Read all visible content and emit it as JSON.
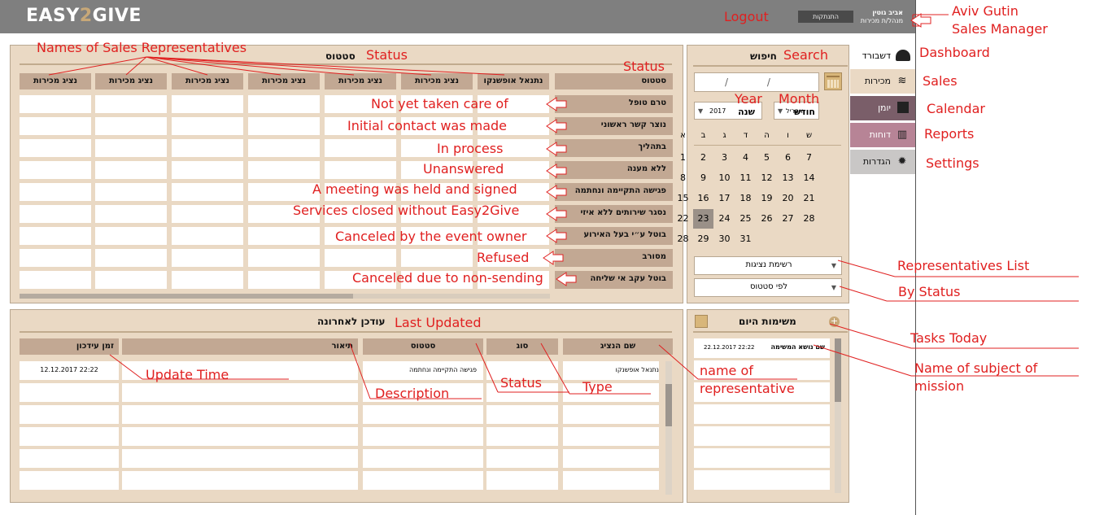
{
  "app": {
    "logo_pre": "EASY",
    "logo_two": "2",
    "logo_post": "GIVE",
    "logout_label": "התנתקות",
    "user_name": "אביב גוטין",
    "user_role": "מנהל/ת מכירות"
  },
  "status_panel": {
    "title": "סטטוס",
    "status_header": "סטטוס",
    "rep_headers": [
      "נתנאל אופשנקו",
      "נציג מכירות",
      "נציג מכירות",
      "נציג מכירות",
      "נציג מכירות",
      "נציג מכירות",
      "נציג מכירות"
    ],
    "statuses": [
      "טרם טופל",
      "נוצר קשר ראשוני",
      "בתהליך",
      "ללא מענה",
      "פגישה התקיימה ונחתמה",
      "נסגר שירותים ללא איזי",
      "בוטל ע״י בעל האירוע",
      "מסורב",
      "בוטל עקב אי שליחה"
    ]
  },
  "last_updated": {
    "title": "עודכן לאחרונה",
    "headers": {
      "rep": "שם הנציג",
      "type": "סוג",
      "status": "סטטוס",
      "desc": "תיאור",
      "time": "זמן עידכון"
    },
    "row1": {
      "rep": "נתנאל אופשנקו",
      "type": "",
      "status": "פגישה התקיימה ונחתמה",
      "desc": "",
      "time": "12.12.2017 22:22"
    }
  },
  "search": {
    "title": "חיפוש",
    "date_placeholder": "/ /",
    "month_label": "חודש",
    "month_value": "אפריל",
    "year_label": "שנה",
    "year_value": "2017",
    "weekdays": [
      "ש",
      "ו",
      "ה",
      "ד",
      "ג",
      "ב",
      "א"
    ],
    "weeks": [
      [
        "7",
        "6",
        "5",
        "4",
        "3",
        "2",
        "1"
      ],
      [
        "14",
        "13",
        "12",
        "11",
        "10",
        "9",
        "8"
      ],
      [
        "21",
        "20",
        "19",
        "18",
        "17",
        "16",
        "15"
      ],
      [
        "28",
        "27",
        "26",
        "25",
        "24",
        "23",
        "22"
      ],
      [
        "",
        "",
        "",
        "31",
        "30",
        "29",
        "28"
      ]
    ],
    "rep_list": "רשימת נציגות",
    "by_status": "לפי סטטוס"
  },
  "tasks": {
    "title": "משימות היום",
    "item_subject": "שם נושא המשימה",
    "item_time": "22.12.2017 22:22"
  },
  "sidebar": {
    "dashboard": "דשבורד",
    "sales": "מכירות",
    "calendar": "יומן",
    "reports": "דוחות",
    "settings": "הגדרות"
  },
  "annotations": {
    "logout": "Logout",
    "aviv": "Aviv Gutin",
    "sales_manager": "Sales Manager",
    "names_reps": "Names of Sales Representatives",
    "status_top": "Status",
    "status_col": "Status",
    "search": "Search",
    "dashboard": "Dashboard",
    "sales": "Sales",
    "calendar": "Calendar",
    "reports": "Reports",
    "settings": "Settings",
    "year": "Year",
    "month": "Month",
    "not_yet": "Not yet taken care of",
    "initial": "Initial contact was made",
    "in_process": "In process",
    "unanswered": "Unanswered",
    "meeting": "A meeting was held and signed",
    "closed": "Services closed without Easy2Give",
    "canceled_owner": "Canceled by the event owner",
    "refused": "Refused",
    "canceled_non": "Canceled due to non-sending",
    "reps_list": "Representatives List",
    "by_status": "By Status",
    "tasks_today": "Tasks Today",
    "name_subject1": "Name of subject of",
    "name_subject2": "mission",
    "last_updated": "Last Updated",
    "update_time": "Update Time",
    "description": "Description",
    "status_lu": "Status",
    "type": "Type",
    "name_rep1": "name of",
    "name_rep2": "representative"
  }
}
